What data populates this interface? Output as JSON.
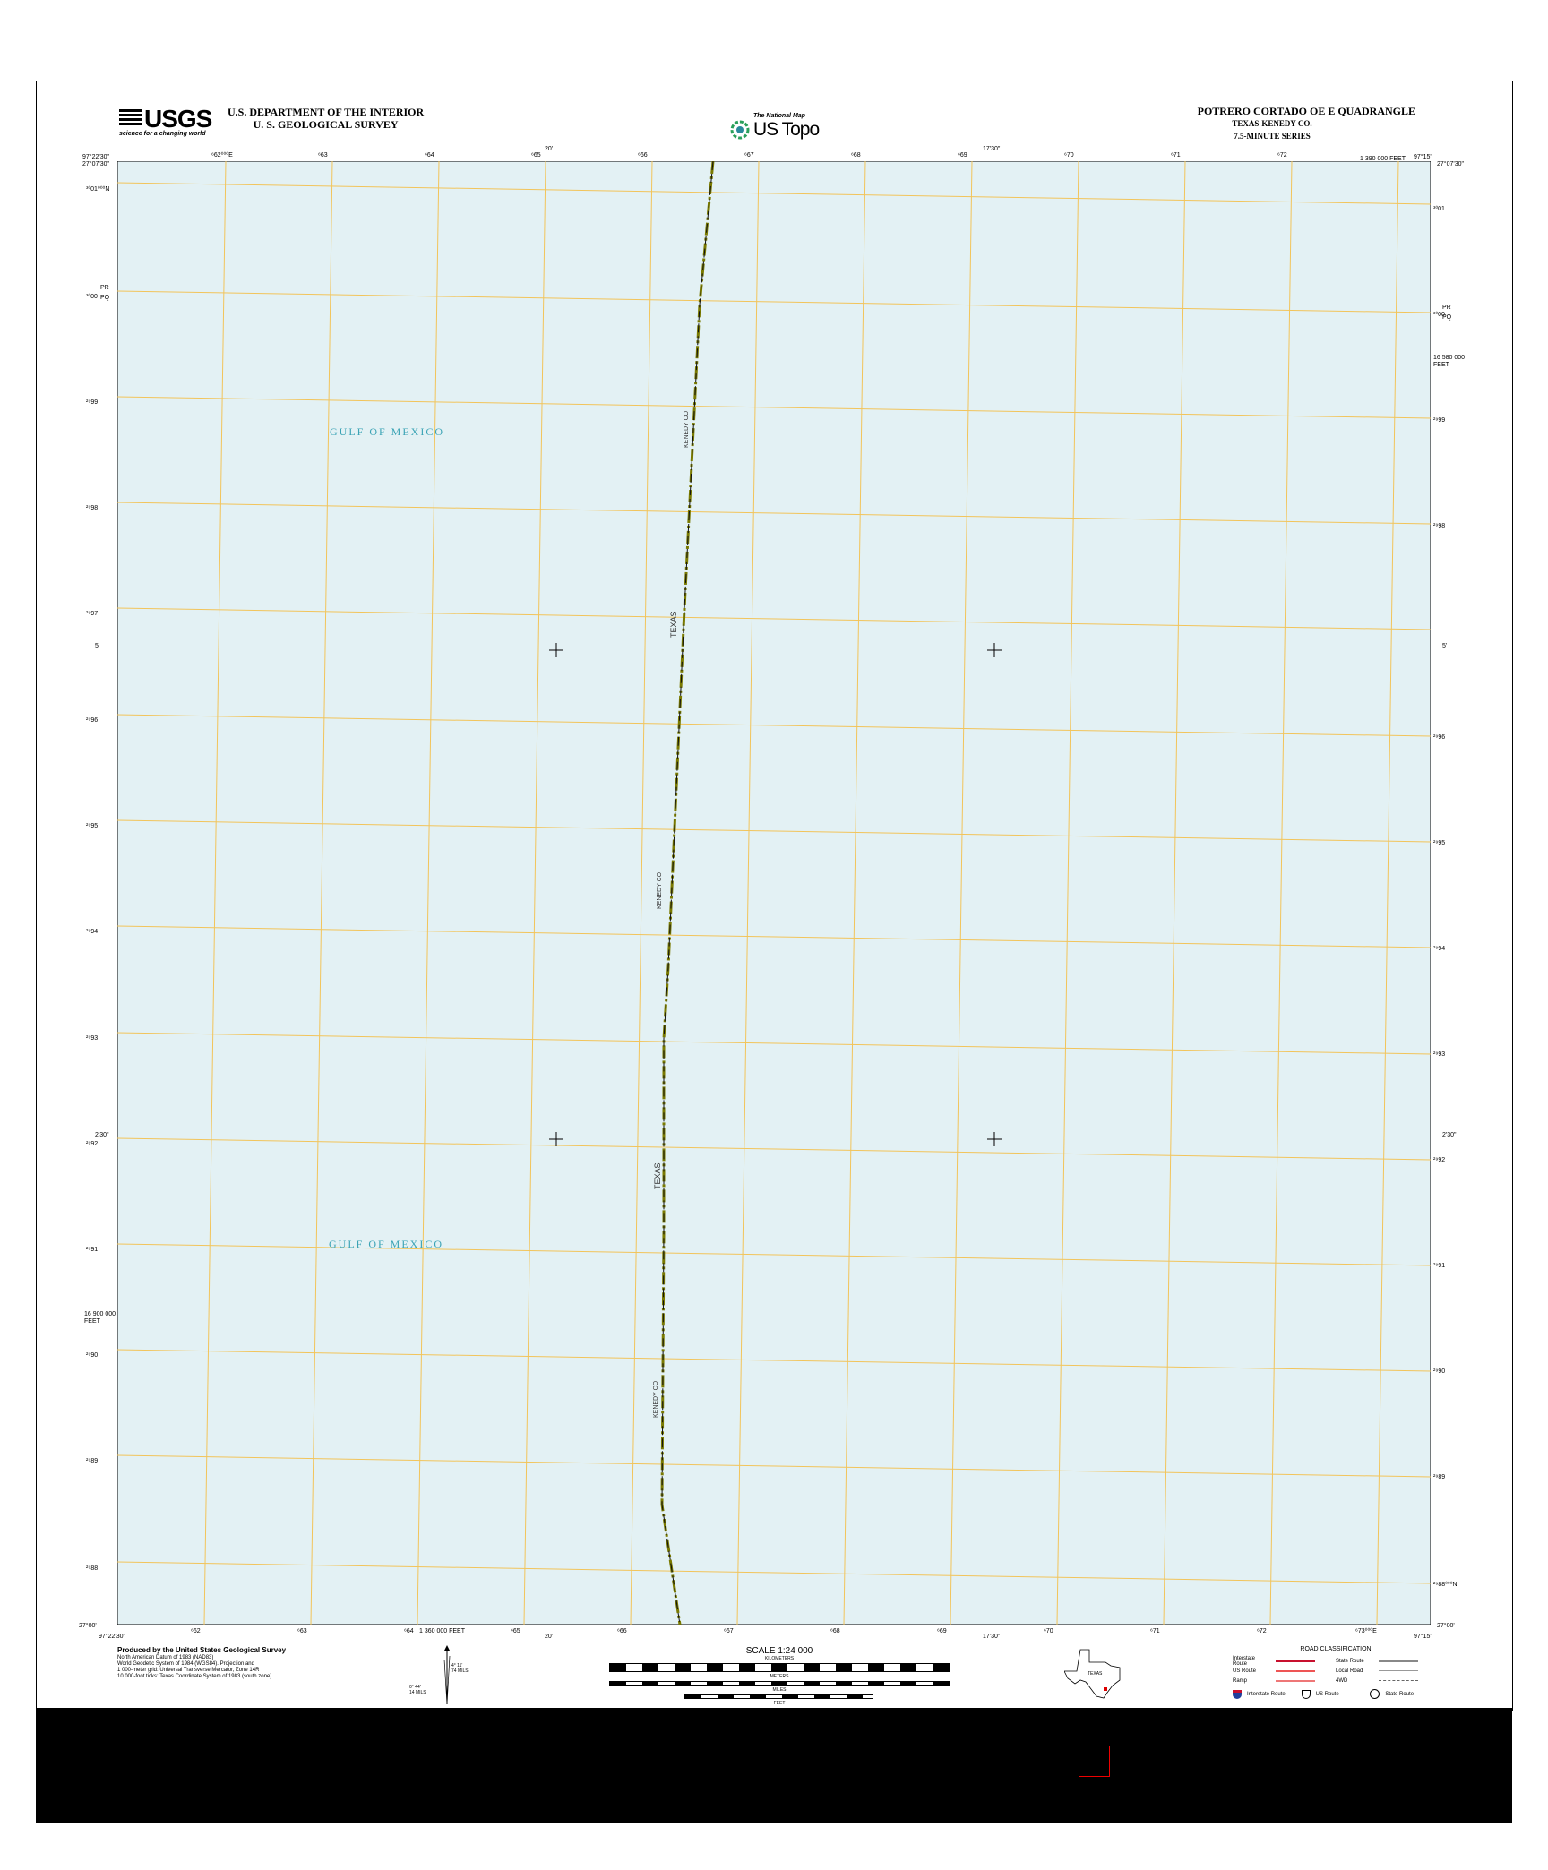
{
  "header": {
    "usgs_wordmark": "USGS",
    "usgs_tagline": "science for a changing world",
    "department_line1": "U.S. DEPARTMENT OF THE INTERIOR",
    "department_line2": "U. S. GEOLOGICAL SURVEY",
    "national_map_tagline": "The National Map",
    "us_topo": "US Topo",
    "quad_title": "POTRERO CORTADO OE E QUADRANGLE",
    "quad_state": "TEXAS-KENEDY CO.",
    "quad_series": "7.5-MINUTE SERIES"
  },
  "map": {
    "water_color": "#e3f1f4",
    "grid_color": "#f2c45a",
    "boundary_color": "#000000",
    "corners": {
      "top_left_lon": "97°22'30\"",
      "top_left_lat": "27°07'30\"",
      "top_right_lon": "97°15'",
      "top_right_lat": "27°07'30\"",
      "bottom_left_lon": "97°22'30\"",
      "bottom_left_lat": "27°00'",
      "bottom_right_lon": "97°15'",
      "bottom_right_lat": "27°00'"
    },
    "top_ticks": [
      "⁶62⁰⁰⁰E",
      "⁶63",
      "⁶64",
      "⁶65",
      "⁶66",
      "⁶67",
      "⁶68",
      "⁶69",
      "⁶70",
      "⁶71",
      "⁶72"
    ],
    "bottom_ticks": [
      "⁶62",
      "⁶63",
      "⁶64",
      "⁶65",
      "⁶66",
      "⁶67",
      "⁶68",
      "⁶69",
      "⁶70",
      "⁶71",
      "⁶72",
      "⁶73⁰⁰⁰E"
    ],
    "left_ticks": [
      "³⁰01⁰⁰⁰N",
      "³⁰00",
      "²⁹99",
      "²⁹98",
      "²⁹97",
      "²⁹96",
      "²⁹95",
      "²⁹94",
      "²⁹93",
      "²⁹92",
      "²⁹91",
      "²⁹90",
      "²⁹89",
      "²⁹88"
    ],
    "right_ticks": [
      "³⁰01",
      "³⁰00",
      "²⁹99",
      "²⁹98",
      "²⁹96",
      "²⁹95",
      "²⁹94",
      "²⁹93",
      "²⁹92",
      "²⁹91",
      "²⁹90",
      "²⁹89",
      "²⁹88⁰⁰⁰N"
    ],
    "top_minute_labels": [
      "20'",
      "17'30\""
    ],
    "bottom_minute_labels": [
      "20'",
      "17'30\""
    ],
    "side_minute_labels": [
      "5'",
      "2'30\""
    ],
    "feet_labels": {
      "top": "1 390 000 FEET",
      "bottom": "1 360 000 FEET",
      "right": "16 580 000\nFEET",
      "left": "16 900 000\nFEET"
    },
    "pr_pq": "PR\nPQ",
    "water_labels": [
      "GULF OF MEXICO",
      "GULF OF MEXICO"
    ],
    "boundary_labels": [
      "KENEDY CO",
      "TEXAS",
      "KENEDY CO",
      "TEXAS",
      "KENEDY CO"
    ]
  },
  "footer": {
    "produced_by": "Produced by the United States Geological Survey",
    "datum_lines": [
      "North American Datum of 1983 (NAD83)",
      "World Geodetic System of 1984 (WGS84). Projection and",
      "1 000-meter grid: Universal Transverse Mercator, Zone 14R",
      "10 000-foot ticks: Texas Coordinate System of 1983 (south zone)"
    ],
    "declination": {
      "gn": "0° 44'\n14 MILS",
      "mn": "4° 11'\n74 MILS"
    },
    "scale_title": "SCALE 1:24 000",
    "scale_units": [
      "KILOMETERS",
      "METERS",
      "MILES",
      "FEET"
    ],
    "state_name": "TEXAS",
    "road_classification_title": "ROAD CLASSIFICATION",
    "road_rows": [
      {
        "left": "Interstate Route",
        "right": "State Route"
      },
      {
        "left": "US Route",
        "right": "Local Road"
      },
      {
        "left": "Ramp",
        "right": "4WD"
      }
    ],
    "shield_labels": [
      "Interstate Route",
      "US Route",
      "State Route"
    ]
  }
}
